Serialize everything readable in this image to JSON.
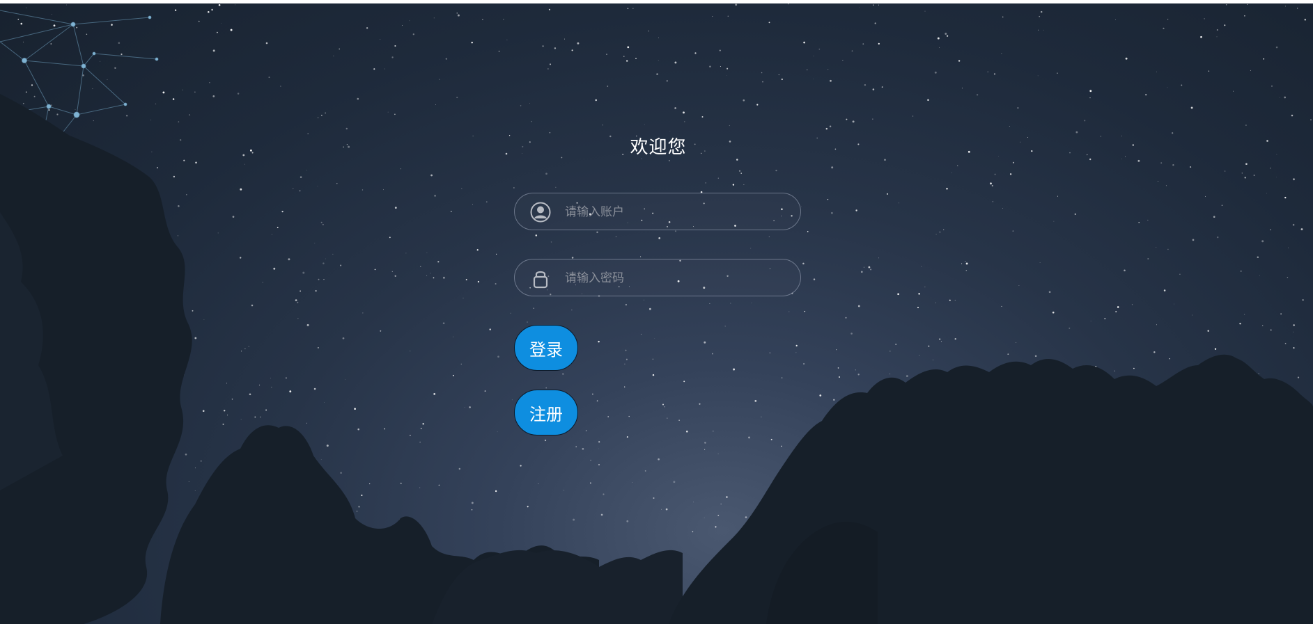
{
  "login": {
    "title": "欢迎您",
    "account": {
      "placeholder": "请输入账户",
      "value": "",
      "icon": "user-icon"
    },
    "password": {
      "placeholder": "请输入密码",
      "value": "",
      "icon": "lock-icon"
    },
    "login_button": "登录",
    "register_button": "注册"
  },
  "theme": {
    "button_color": "#0e8ee0",
    "sky_color": "#273448",
    "tree_color": "#161f29"
  }
}
